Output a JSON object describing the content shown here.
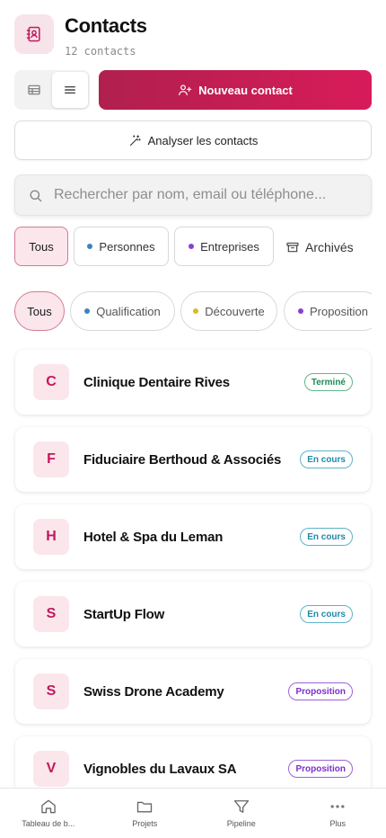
{
  "header": {
    "title": "Contacts",
    "count": "12 contacts",
    "icon": "address-book-icon"
  },
  "toolbar": {
    "new_contact_label": "Nouveau contact",
    "analyze_label": "Analyser les contacts",
    "view_mode": "list"
  },
  "search": {
    "placeholder": "Rechercher par nom, email ou téléphone..."
  },
  "type_filters": [
    {
      "label": "Tous",
      "active": true
    },
    {
      "label": "Personnes",
      "dot_color": "#3b82c4"
    },
    {
      "label": "Entreprises",
      "dot_color": "#8a3fd1"
    }
  ],
  "archives_label": "Archivés",
  "stage_filters": [
    {
      "label": "Tous",
      "active": true
    },
    {
      "label": "Qualification",
      "dot_color": "#3b82c4"
    },
    {
      "label": "Découverte",
      "dot_color": "#e0b81f"
    },
    {
      "label": "Proposition",
      "dot_color": "#8a3fd1"
    }
  ],
  "contacts": [
    {
      "initial": "C",
      "name": "Clinique Dentaire Rives",
      "status": "Terminé",
      "status_type": "done"
    },
    {
      "initial": "F",
      "name": "Fiduciaire Berthoud & Associés",
      "status": "En cours",
      "status_type": "progress"
    },
    {
      "initial": "H",
      "name": "Hotel & Spa du Leman",
      "status": "En cours",
      "status_type": "progress"
    },
    {
      "initial": "S",
      "name": "StartUp Flow",
      "status": "En cours",
      "status_type": "progress"
    },
    {
      "initial": "S",
      "name": "Swiss Drone Academy",
      "status": "Proposition",
      "status_type": "proposal"
    },
    {
      "initial": "V",
      "name": "Vignobles du Lavaux SA",
      "status": "Proposition",
      "status_type": "proposal"
    }
  ],
  "bottom_nav": [
    {
      "label": "Tableau de b...",
      "icon": "home-icon"
    },
    {
      "label": "Projets",
      "icon": "folder-icon"
    },
    {
      "label": "Pipeline",
      "icon": "filter-icon"
    },
    {
      "label": "Plus",
      "icon": "more-icon"
    }
  ],
  "colors": {
    "accent": "#c2185b",
    "accent_soft": "#fbe6ec"
  }
}
